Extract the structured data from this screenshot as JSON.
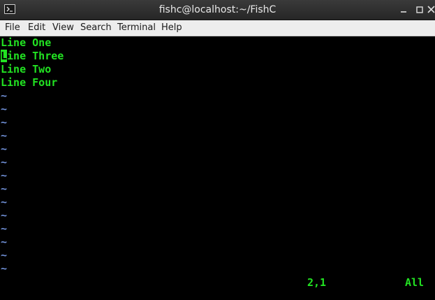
{
  "window": {
    "title": "fishc@localhost:~/FishC"
  },
  "menu": {
    "items": [
      "File",
      "Edit",
      "View",
      "Search",
      "Terminal",
      "Help"
    ]
  },
  "terminal": {
    "lines": [
      {
        "text": "Line One"
      },
      {
        "cursor_char": "L",
        "rest": "ine Three"
      },
      {
        "text": "Line Two"
      },
      {
        "text": "Line Four"
      }
    ],
    "tilde": "~",
    "status_position": "2,1",
    "status_view": "All",
    "colors": {
      "text": "#22e222",
      "tilde": "#6f8fd6",
      "background": "#000000"
    }
  },
  "icons": {
    "app": "terminal-icon",
    "minimize": "minimize-icon",
    "maximize": "maximize-icon",
    "close": "close-icon"
  }
}
